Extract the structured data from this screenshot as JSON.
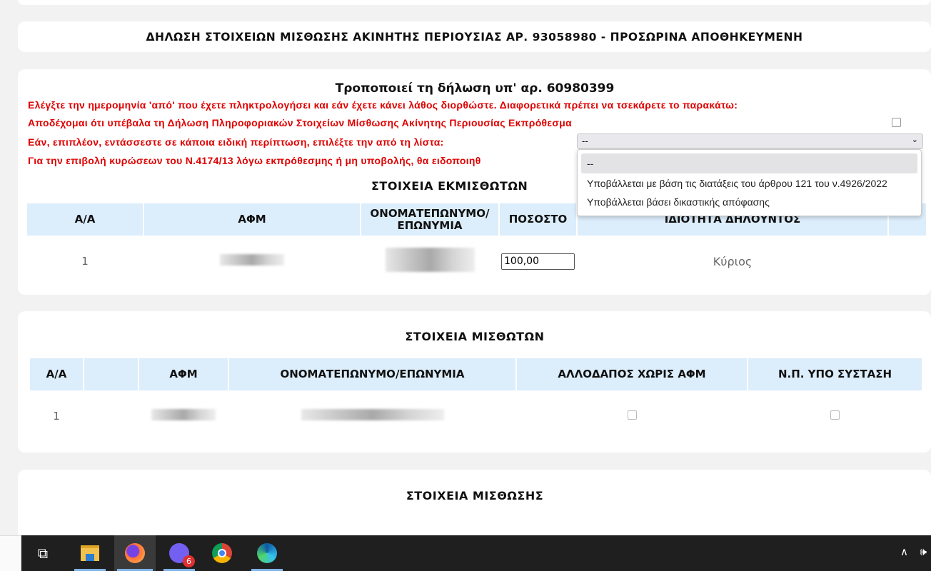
{
  "header": {
    "title": "ΔΗΛΩΣΗ ΣΤΟΙΧΕΙΩΝ ΜΙΣΘΩΣΗΣ ΑΚΙΝΗΤΗΣ ΠΕΡΙΟΥΣΙΑΣ ΑΡ. 93058980 - ΠΡΟΣΩΡΙΝΑ ΑΠΟΘΗΚΕΥΜΕΝΗ"
  },
  "declaration": {
    "amends": "Τροποποιεί τη δήλωση υπ' αρ. 60980399",
    "warning1": "Ελέγξτε την ημερομηνία 'από' που έχετε πληκτρολογήσει και εάν έχετε κάνει λάθος διορθώστε. Διαφορετικά πρέπει να τσεκάρετε το παρακάτω:",
    "accept_late": "Αποδέχομαι ότι υπέβαλα τη Δήλωση Πληροφοριακών Στοιχείων Μίσθωσης Ακίνητης Περιουσίας Εκπρόθεσμα",
    "special_case": "Εάν, επιπλέον, εντάσσεστε σε κάποια ειδική περίπτωση, επιλέξτε την από τη λίστα:",
    "sanctions": "Για την επιβολή κυρώσεων του Ν.4174/13 λόγω εκπρόθεσμης ή μη υποβολής, θα ειδοποιηθ",
    "select_value": "--",
    "options": [
      "--",
      "Υποβάλλεται με βάση τις διατάξεις του άρθρου 121 του ν.4926/2022",
      "Υποβάλλεται βάσει δικαστικής απόφασης"
    ]
  },
  "lessors": {
    "title": "ΣΤΟΙΧΕΙΑ ΕΚΜΙΣΘΩΤΩΝ",
    "columns": [
      "Α/Α",
      "ΑΦΜ",
      "ΟΝΟΜΑΤΕΠΩΝΥΜΟ/ ΕΠΩΝΥΜΙΑ",
      "ΠΟΣΟΣΤΟ",
      "ΙΔΙΟΤΗΤΑ ΔΗΛΟΥΝΤΟΣ",
      ""
    ],
    "rows": [
      {
        "aa": "1",
        "percent": "100,00",
        "role": "Κύριος"
      }
    ]
  },
  "lessees": {
    "title": "ΣΤΟΙΧΕΙΑ ΜΙΣΘΩΤΩΝ",
    "columns": [
      "Α/Α",
      "",
      "ΑΦΜ",
      "ΟΝΟΜΑΤΕΠΩΝΥΜΟ/ΕΠΩΝΥΜΙΑ",
      "ΑΛΛΟΔΑΠΟΣ ΧΩΡΙΣ ΑΦΜ",
      "Ν.Π. ΥΠΟ ΣΥΣΤΑΣΗ"
    ],
    "rows": [
      {
        "aa": "1"
      }
    ]
  },
  "lease": {
    "title": "ΣΤΟΙΧΕΙΑ ΜΙΣΘΩΣΗΣ"
  },
  "taskbar": {
    "apps": [
      "task-view",
      "file-explorer",
      "firefox",
      "viber",
      "chrome",
      "edge"
    ],
    "viber_badge": "6"
  }
}
